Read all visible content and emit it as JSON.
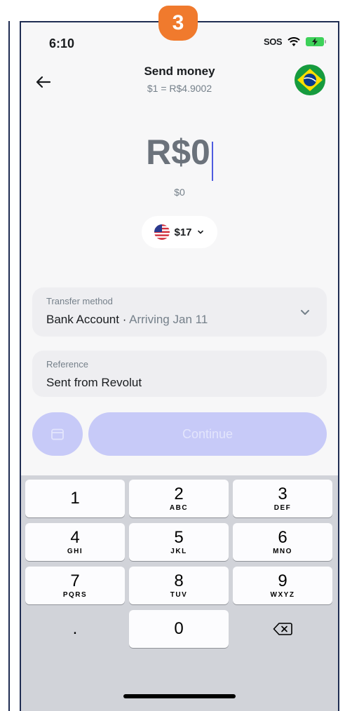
{
  "step_badge": "3",
  "status": {
    "time": "6:10",
    "sos": "SOS"
  },
  "header": {
    "title": "Send money",
    "rate": "$1 = R$4.9002",
    "back_icon": "arrow-left-icon",
    "flag_icon": "brazil-flag-icon"
  },
  "amount": {
    "value": "R$0",
    "converted": "$0"
  },
  "currency_selector": {
    "label": "$17",
    "flag_icon": "us-flag-icon"
  },
  "transfer_method": {
    "label": "Transfer method",
    "value": "Bank Account",
    "separator": " · ",
    "eta": "Arriving Jan 11"
  },
  "reference": {
    "label": "Reference",
    "value": "Sent from Revolut"
  },
  "actions": {
    "continue_label": "Continue",
    "schedule_icon": "calendar-icon"
  },
  "keyboard": {
    "keys": [
      {
        "num": "1",
        "letters": ""
      },
      {
        "num": "2",
        "letters": "ABC"
      },
      {
        "num": "3",
        "letters": "DEF"
      },
      {
        "num": "4",
        "letters": "GHI"
      },
      {
        "num": "5",
        "letters": "JKL"
      },
      {
        "num": "6",
        "letters": "MNO"
      },
      {
        "num": "7",
        "letters": "PQRS"
      },
      {
        "num": "8",
        "letters": "TUV"
      },
      {
        "num": "9",
        "letters": "WXYZ"
      },
      {
        "num": ".",
        "letters": ""
      },
      {
        "num": "0",
        "letters": ""
      }
    ],
    "delete_icon": "backspace-icon"
  },
  "colors": {
    "accent": "#4f5ce0",
    "button_disabled": "#c7caf8",
    "badge": "#f07a2d"
  }
}
